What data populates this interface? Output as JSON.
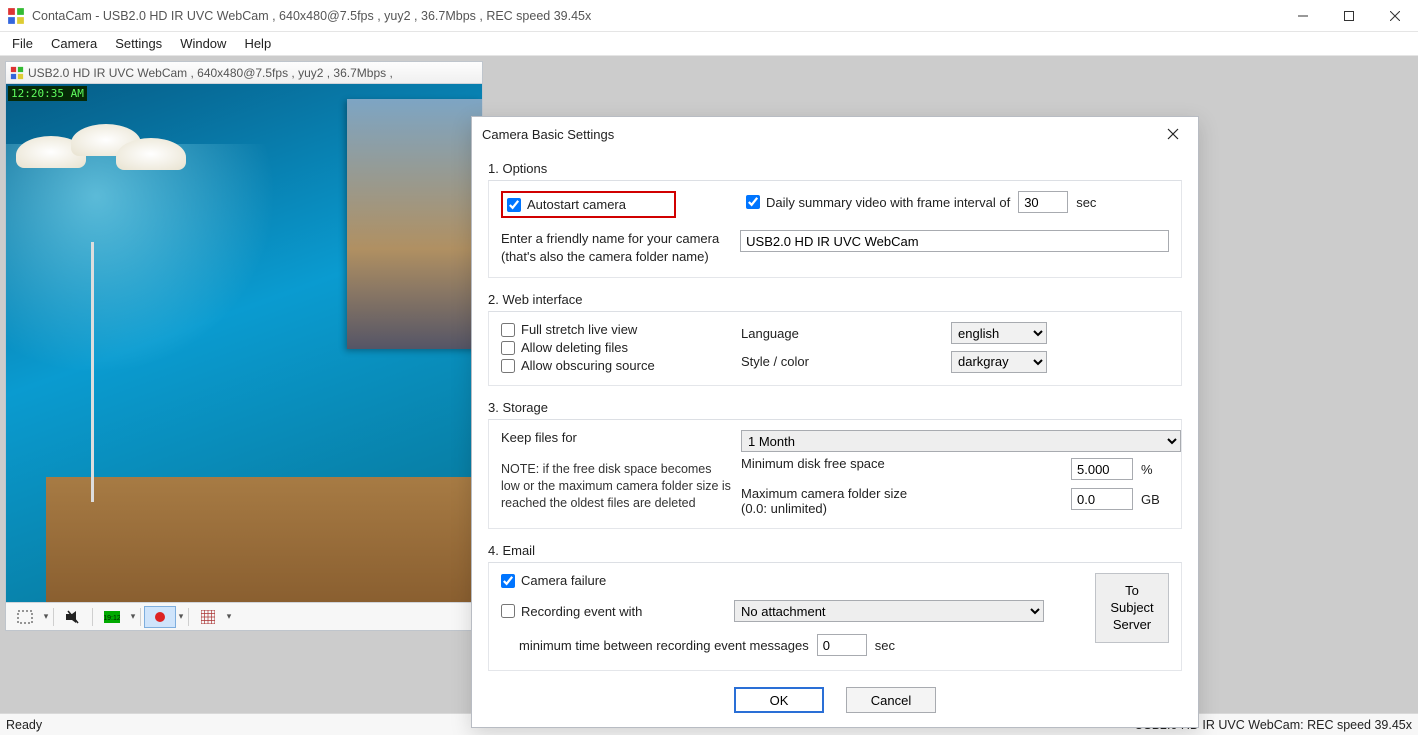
{
  "title": "ContaCam - USB2.0 HD IR UVC WebCam , 640x480@7.5fps , yuy2 , 36.7Mbps , REC speed 39.45x",
  "menu": [
    "File",
    "Camera",
    "Settings",
    "Window",
    "Help"
  ],
  "mdi": {
    "title": "USB2.0 HD IR UVC WebCam , 640x480@7.5fps , yuy2 , 36.7Mbps ,",
    "timestamp": "12:20:35 AM"
  },
  "statusbar": {
    "left": "Ready",
    "right": "USB2.0 HD IR UVC WebCam: REC speed 39.45x"
  },
  "dialog": {
    "title": "Camera Basic Settings",
    "sections": {
      "options": {
        "head": "1. Options",
        "autostart": "Autostart camera",
        "dailySummary": "Daily summary video with frame interval of",
        "dailyVal": "30",
        "dailyUnit": "sec",
        "nameHint1": "Enter a friendly name for your camera",
        "nameHint2": "(that's also the camera folder name)",
        "nameVal": "USB2.0 HD IR UVC WebCam"
      },
      "web": {
        "head": "2. Web interface",
        "lang": "Language",
        "langVal": "english",
        "style": "Style / color",
        "styleVal": "darkgray",
        "chk1": "Full stretch live view",
        "chk2": "Allow deleting files",
        "chk3": "Allow obscuring source"
      },
      "storage": {
        "head": "3. Storage",
        "keep": "Keep files for",
        "keepVal": "1 Month",
        "minFree": "Minimum disk free space",
        "minFreeVal": "5.000",
        "minFreeUnit": "%",
        "maxFolder1": "Maximum camera folder size",
        "maxFolder2": "(0.0: unlimited)",
        "maxFolderVal": "0.0",
        "maxFolderUnit": "GB",
        "note": "NOTE: if the free disk space becomes low or the maximum camera folder size is reached the oldest files are deleted"
      },
      "email": {
        "head": "4. Email",
        "camFail": "Camera failure",
        "recEvt": "Recording event with",
        "attachVal": "No attachment",
        "minTime": "minimum time between recording event messages",
        "minTimeVal": "0",
        "minTimeUnit": "sec",
        "btn": "To\nSubject\nServer"
      }
    },
    "ok": "OK",
    "cancel": "Cancel"
  }
}
